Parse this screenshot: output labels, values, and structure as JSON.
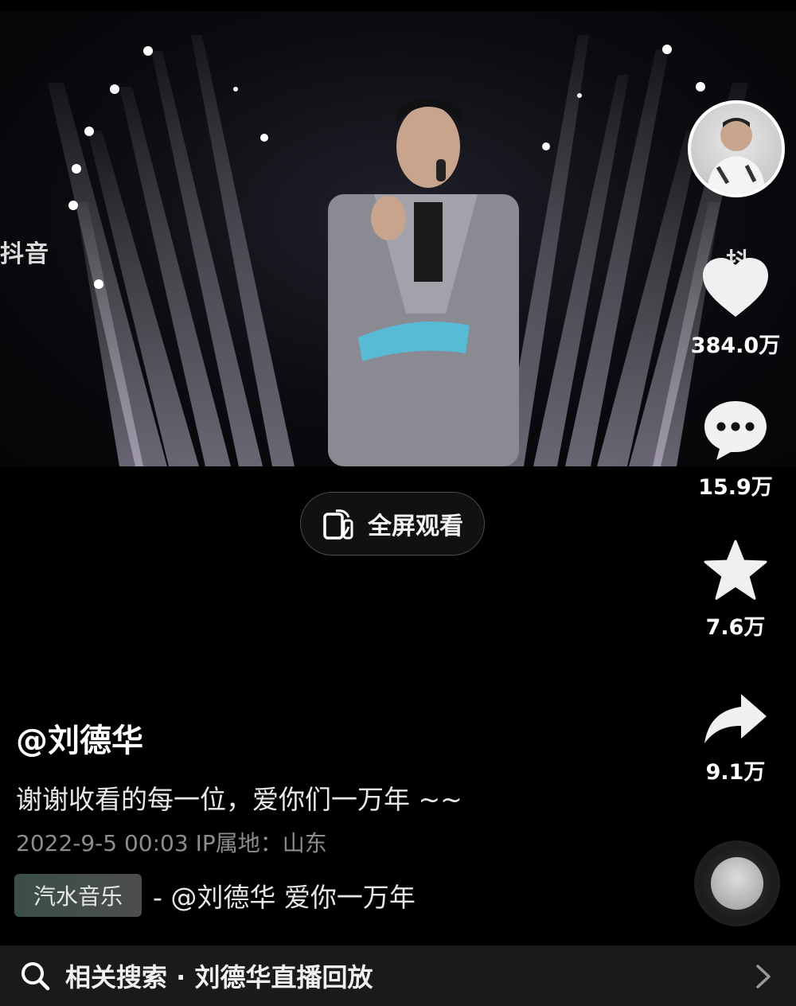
{
  "video": {
    "watermark_left": "抖音",
    "watermark_right": "抖"
  },
  "fullscreen": {
    "label": "全屏观看"
  },
  "rail": {
    "likes": "384.0万",
    "comments": "15.9万",
    "favorites": "7.6万",
    "shares": "9.1万"
  },
  "post": {
    "author": "@刘德华",
    "caption": "谢谢收看的每一位，爱你们一万年 ~~",
    "meta": "2022-9-5 00:03   IP属地：山东",
    "music_badge": "汽水音乐",
    "music_text": "- @刘德华    爱你一万年"
  },
  "related_search": {
    "text": "相关搜索 · 刘德华直播回放"
  },
  "colors": {
    "background": "#000000",
    "search_bar": "#1a1a1a",
    "meta_text": "#8d8d8d"
  },
  "icons": [
    "phone-rotate-icon",
    "heart-icon",
    "comment-icon",
    "star-icon",
    "share-icon",
    "search-icon",
    "chevron-right-icon"
  ]
}
